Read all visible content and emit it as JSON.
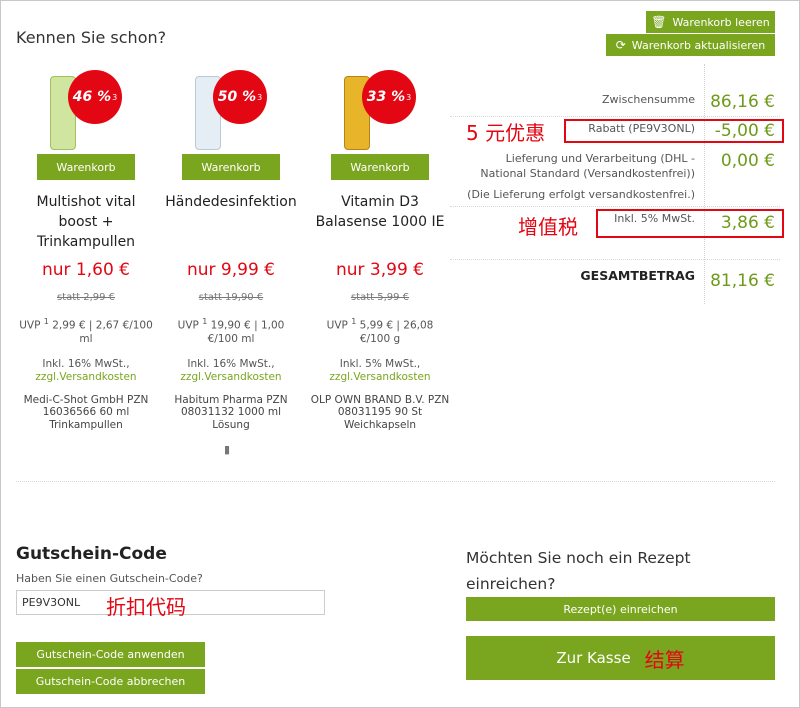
{
  "header": {
    "clear_cart": "Warenkorb leeren",
    "refresh_cart": "Warenkorb aktualisieren",
    "section_title": "Kennen Sie schon?"
  },
  "products": [
    {
      "badge": "46 %",
      "badge_note": "3",
      "cart_button": "Warenkorb",
      "name": "Multishot vital boost + Trinkampullen",
      "price": "nur 1,60 €",
      "old_price": "statt 2,99 €",
      "uvp_label": "UVP",
      "uvp_note": "1",
      "uvp_value": "2,99 € | 2,67 €/100 ml",
      "tax": "Inkl. 16% MwSt.,",
      "shipping": "zzgl.Versandkosten",
      "maker": "Medi-C-Shot GmbH PZN 16036566 60 ml Trinkampullen",
      "bottle_color": "#cfe5a0"
    },
    {
      "badge": "50 %",
      "badge_note": "3",
      "cart_button": "Warenkorb",
      "name": "Händedesinfektion",
      "price": "nur 9,99 €",
      "old_price": "statt 19,90 €",
      "uvp_label": "UVP",
      "uvp_note": "1",
      "uvp_value": "19,90 € | 1,00 €/100 ml",
      "tax": "Inkl. 16% MwSt.,",
      "shipping": "zzgl.Versandkosten",
      "maker": "Habitum Pharma PZN 08031132 1000 ml Lösung",
      "bottle_color": "#e4eef4"
    },
    {
      "badge": "33 %",
      "badge_note": "3",
      "cart_button": "Warenkorb",
      "name": "Vitamin D3 Balasense 1000 IE",
      "price": "nur 3,99 €",
      "old_price": "statt 5,99 €",
      "uvp_label": "UVP",
      "uvp_note": "1",
      "uvp_value": "5,99 € | 26,08 €/100 g",
      "tax": "Inkl. 5% MwSt.,",
      "shipping": "zzgl.Versandkosten",
      "maker": "OLP OWN BRAND B.V. PZN 08031195 90 St Weichkapseln",
      "bottle_color": "#e8b42a"
    }
  ],
  "summary": {
    "subtotal_label": "Zwischensumme",
    "subtotal_value": "86,16 €",
    "discount_label": "Rabatt (PE9V3ONL)",
    "discount_value": "-5,00 €",
    "shipping_label": "Lieferung und Verarbeitung (DHL - National Standard (Versandkostenfrei))",
    "shipping_value": "0,00 €",
    "shipping_note": "(Die Lieferung erfolgt versandkostenfrei.)",
    "vat_label": "Inkl. 5% MwSt.",
    "vat_value": "3,86 €",
    "total_label": "GESAMTBETRAG",
    "total_value": "81,16 €"
  },
  "annotations": {
    "discount": "5 元优惠",
    "vat": "增值税",
    "coupon": "折扣代码",
    "checkout": "结算"
  },
  "coupon": {
    "title": "Gutschein-Code",
    "question": "Haben Sie einen Gutschein-Code?",
    "value": "PE9V3ONL",
    "apply": "Gutschein-Code anwenden",
    "cancel": "Gutschein-Code abbrechen"
  },
  "rezept": {
    "question": "Möchten Sie noch ein Rezept einreichen?",
    "submit": "Rezept(e) einreichen",
    "checkout": "Zur Kasse"
  },
  "colors": {
    "brand_green": "#7aa51f",
    "price_red": "#e30613",
    "value_green": "#6e9a1a"
  }
}
